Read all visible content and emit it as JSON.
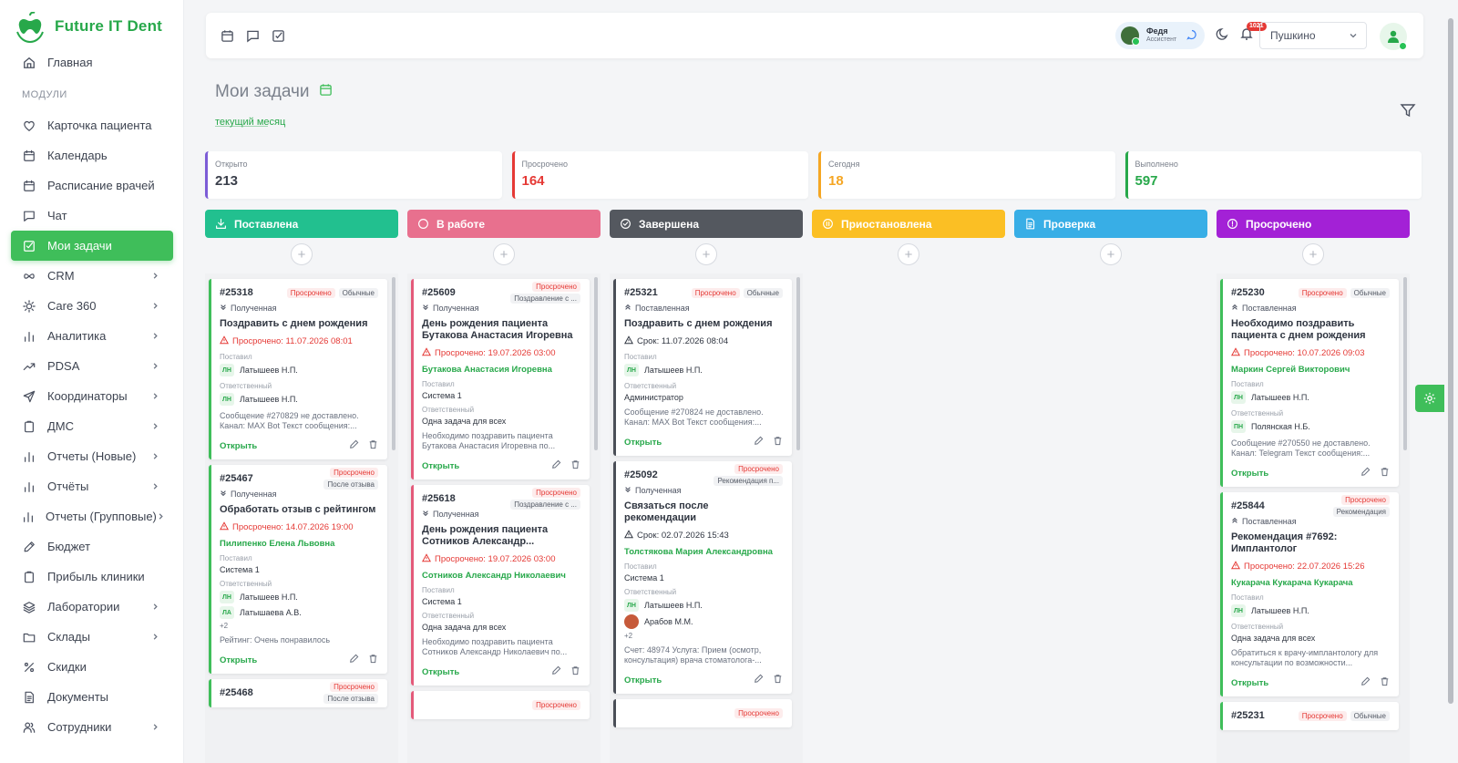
{
  "app": {
    "name": "Future IT Dent"
  },
  "colors": {
    "brand": "#27a84a",
    "active": "#3fbe5a",
    "overdue": "#e53935"
  },
  "sidebar": {
    "home": {
      "label": "Главная",
      "icon": "home-icon"
    },
    "section_label": "МОДУЛИ",
    "items": [
      {
        "label": "Карточка пациента",
        "icon": "heart-icon",
        "chevron": false
      },
      {
        "label": "Календарь",
        "icon": "calendar-icon",
        "chevron": false
      },
      {
        "label": "Расписание врачей",
        "icon": "calendar-icon",
        "chevron": false
      },
      {
        "label": "Чат",
        "icon": "chat-icon",
        "chevron": false
      },
      {
        "label": "Мои задачи",
        "icon": "checkbox-icon",
        "chevron": false,
        "active": true
      },
      {
        "label": "CRM",
        "icon": "infinity-icon",
        "chevron": true
      },
      {
        "label": "Care 360",
        "icon": "sun-icon",
        "chevron": true
      },
      {
        "label": "Аналитика",
        "icon": "bar-chart-icon",
        "chevron": true
      },
      {
        "label": "PDSA",
        "icon": "trend-icon",
        "chevron": true
      },
      {
        "label": "Координаторы",
        "icon": "send-icon",
        "chevron": true
      },
      {
        "label": "ДМС",
        "icon": "clipboard-icon",
        "chevron": true
      },
      {
        "label": "Отчеты (Новые)",
        "icon": "bar-chart-icon",
        "chevron": true
      },
      {
        "label": "Отчёты",
        "icon": "bar-chart-icon",
        "chevron": true
      },
      {
        "label": "Отчеты (Групповые)",
        "icon": "bar-chart-icon",
        "chevron": true
      },
      {
        "label": "Бюджет",
        "icon": "pen-icon",
        "chevron": false
      },
      {
        "label": "Прибыль клиники",
        "icon": "clipboard-icon",
        "chevron": false
      },
      {
        "label": "Лаборатории",
        "icon": "layers-icon",
        "chevron": true
      },
      {
        "label": "Склады",
        "icon": "folder-icon",
        "chevron": true
      },
      {
        "label": "Скидки",
        "icon": "percent-icon",
        "chevron": false
      },
      {
        "label": "Документы",
        "icon": "document-icon",
        "chevron": false
      },
      {
        "label": "Сотрудники",
        "icon": "users-icon",
        "chevron": true
      }
    ]
  },
  "header": {
    "user": {
      "name": "Федя",
      "role": "Ассистент"
    },
    "notifications_count": "1021",
    "branch": "Пушкино"
  },
  "page": {
    "title": "Мои задачи",
    "period": "текущий месяц"
  },
  "stats": [
    {
      "label": "Открыто",
      "value": "213",
      "color": "#7c5cd6",
      "value_color": "#3a3f4b"
    },
    {
      "label": "Просрочено",
      "value": "164",
      "color": "#e53935",
      "value_color": "#e53935"
    },
    {
      "label": "Сегодня",
      "value": "18",
      "color": "#f5a623",
      "value_color": "#f5a623"
    },
    {
      "label": "Выполнено",
      "value": "597",
      "color": "#27a84a",
      "value_color": "#27a84a"
    }
  ],
  "columns": [
    {
      "title": "Поставлена",
      "color": "#22c08f",
      "icon": "download-icon",
      "cards": [
        {
          "id": "#25318",
          "badges": [
            "Просрочено",
            "Обычные"
          ],
          "badge_layout": "row",
          "source": "Полученная",
          "source_icon": "double-chevron-down-icon",
          "title": "Поздравить с днем рождения",
          "due": "Просрочено: 11.07.2026 08:01",
          "due_type": "overdue",
          "patient": "",
          "set_by": {
            "label": "Поставил",
            "ini": "ЛН",
            "name": "Латышеев Н.П."
          },
          "responsible": {
            "label": "Ответственный",
            "people": [
              {
                "ini": "ЛН",
                "name": "Латышеев Н.П."
              }
            ],
            "more": ""
          },
          "desc": "Сообщение #270829 не доставлено. Канал: MAX Bot Текст сообщения:...",
          "open": "Открыть",
          "border": "green"
        },
        {
          "id": "#25467",
          "badges": [
            "Просрочено",
            "После отзыва"
          ],
          "badge_layout": "col",
          "source": "Полученная",
          "source_icon": "double-chevron-down-icon",
          "title": "Обработать отзыв с рейтингом",
          "due": "Просрочено: 14.07.2026 19:00",
          "due_type": "overdue",
          "patient": "Пилипенко Елена Львовна",
          "set_by": {
            "label": "Поставил",
            "ini": "",
            "name": "Система 1"
          },
          "responsible": {
            "label": "Ответственный",
            "people": [
              {
                "ini": "ЛН",
                "name": "Латышеев Н.П."
              },
              {
                "ini": "ЛА",
                "name": "Латышаева А.В."
              }
            ],
            "more": "+2"
          },
          "desc": "Рейтинг: Очень понравилось",
          "open": "Открыть",
          "border": "green"
        },
        {
          "id": "#25468",
          "badges": [
            "Просрочено",
            "После отзыва"
          ],
          "badge_layout": "col",
          "source": "",
          "title": "",
          "due": "",
          "patient": "",
          "desc": "",
          "open": "",
          "border": "green",
          "partial": true
        }
      ]
    },
    {
      "title": "В работе",
      "color": "#e8708e",
      "icon": "circle-icon",
      "cards": [
        {
          "id": "#25609",
          "badges": [
            "Просрочено",
            "Поздравление с ..."
          ],
          "badge_layout": "col",
          "source": "Полученная",
          "source_icon": "double-chevron-down-icon",
          "title": "День рождения пациента Бутакова Анастасия Игоревна",
          "due": "Просрочено: 19.07.2026 03:00",
          "due_type": "overdue",
          "patient": "Бутакова Анастасия Игоревна",
          "set_by": {
            "label": "Поставил",
            "ini": "",
            "name": "Система 1"
          },
          "responsible": {
            "label": "Ответственный",
            "people": [
              {
                "ini": "",
                "name": "Одна задача для всех"
              }
            ],
            "more": ""
          },
          "desc": "Необходимо поздравить пациента Бутакова Анастасия Игоревна по...",
          "open": "Открыть",
          "border": "red"
        },
        {
          "id": "#25618",
          "badges": [
            "Просрочено",
            "Поздравление с ..."
          ],
          "badge_layout": "col",
          "source": "Полученная",
          "source_icon": "double-chevron-down-icon",
          "title": "День рождения пациента Сотников Александр...",
          "due": "Просрочено: 19.07.2026 03:00",
          "due_type": "overdue",
          "patient": "Сотников Александр Николаевич",
          "set_by": {
            "label": "Поставил",
            "ini": "",
            "name": "Система 1"
          },
          "responsible": {
            "label": "Ответственный",
            "people": [
              {
                "ini": "",
                "name": "Одна задача для всех"
              }
            ],
            "more": ""
          },
          "desc": "Необходимо поздравить пациента Сотников Александр Николаевич по...",
          "open": "Открыть",
          "border": "red"
        },
        {
          "id": "",
          "badges": [
            "Просрочено"
          ],
          "badge_layout": "col",
          "source": "",
          "title": "",
          "due": "",
          "patient": "",
          "desc": "",
          "open": "",
          "border": "red",
          "partial": true
        }
      ]
    },
    {
      "title": "Завершена",
      "color": "#54585f",
      "icon": "check-circle-icon",
      "cards": [
        {
          "id": "#25321",
          "badges": [
            "Просрочено",
            "Обычные"
          ],
          "badge_layout": "row",
          "source": "Поставленная",
          "source_icon": "double-chevron-up-icon",
          "title": "Поздравить с днем рождения",
          "due": "Срок: 11.07.2026 08:04",
          "due_type": "neutral",
          "patient": "",
          "set_by": {
            "label": "Поставил",
            "ini": "ЛН",
            "name": "Латышеев Н.П."
          },
          "responsible": {
            "label": "Ответственный",
            "people": [
              {
                "ini": "",
                "name": "Администратор"
              }
            ],
            "more": ""
          },
          "desc": "Сообщение #270824 не доставлено. Канал: MAX Bot Текст сообщения:...",
          "open": "Открыть",
          "border": "dark"
        },
        {
          "id": "#25092",
          "badges": [
            "Просрочено",
            "Рекомендация п..."
          ],
          "badge_layout": "col",
          "source": "Полученная",
          "source_icon": "double-chevron-down-icon",
          "title": "Связаться после рекомендации",
          "due": "Срок: 02.07.2026 15:43",
          "due_type": "neutral",
          "patient": "Толстякова Мария Александровна",
          "set_by": {
            "label": "Поставил",
            "ini": "",
            "name": "Система 1"
          },
          "responsible": {
            "label": "Ответственный",
            "people": [
              {
                "ini": "ЛН",
                "name": "Латышеев Н.П."
              },
              {
                "ini": "avatar",
                "name": "Арабов М.М."
              }
            ],
            "more": "+2"
          },
          "desc": "Счет: 48974 Услуга: Прием (осмотр, консультация) врача стоматолога-...",
          "open": "Открыть",
          "border": "dark"
        },
        {
          "id": "",
          "badges": [
            "Просрочено"
          ],
          "badge_layout": "col",
          "source": "",
          "title": "",
          "due": "",
          "patient": "",
          "desc": "",
          "open": "",
          "border": "dark",
          "partial": true
        }
      ]
    },
    {
      "title": "Приостановлена",
      "color": "#fbbf24",
      "icon": "pause-circle-icon",
      "cards": []
    },
    {
      "title": "Проверка",
      "color": "#38aee6",
      "icon": "document-icon",
      "cards": []
    },
    {
      "title": "Просрочено",
      "color": "#a321d6",
      "icon": "alert-circle-icon",
      "cards": [
        {
          "id": "#25230",
          "badges": [
            "Просрочено",
            "Обычные"
          ],
          "badge_layout": "row",
          "source": "Поставленная",
          "source_icon": "double-chevron-up-icon",
          "title": "Необходимо поздравить пациента с днем рождения",
          "due": "Просрочено: 10.07.2026 09:03",
          "due_type": "overdue",
          "patient": "Маркин Сергей Викторович",
          "set_by": {
            "label": "Поставил",
            "ini": "ЛН",
            "name": "Латышеев Н.П."
          },
          "responsible": {
            "label": "Ответственный",
            "people": [
              {
                "ini": "ПН",
                "name": "Полянская Н.Б."
              }
            ],
            "more": ""
          },
          "desc": "Сообщение #270550 не доставлено. Канал: Telegram Текст сообщения:...",
          "open": "Открыть",
          "border": "green"
        },
        {
          "id": "#25844",
          "badges": [
            "Просрочено",
            "Рекомендация"
          ],
          "badge_layout": "col",
          "source": "Поставленная",
          "source_icon": "double-chevron-up-icon",
          "title": "Рекомендация #7692: Имплантолог",
          "due": "Просрочено: 22.07.2026 15:26",
          "due_type": "overdue",
          "patient": "Кукарача Кукарача Кукарача",
          "set_by": {
            "label": "Поставил",
            "ini": "ЛН",
            "name": "Латышеев Н.П."
          },
          "responsible": {
            "label": "Ответственный",
            "people": [
              {
                "ini": "",
                "name": "Одна задача для всех"
              }
            ],
            "more": ""
          },
          "desc": "Обратиться к врачу-имплантологу для консультации по возможности...",
          "open": "Открыть",
          "border": "green"
        },
        {
          "id": "#25231",
          "badges": [
            "Просрочено",
            "Обычные"
          ],
          "badge_layout": "row",
          "source": "",
          "title": "",
          "due": "",
          "patient": "",
          "desc": "",
          "open": "",
          "border": "green",
          "partial": true
        }
      ]
    }
  ]
}
